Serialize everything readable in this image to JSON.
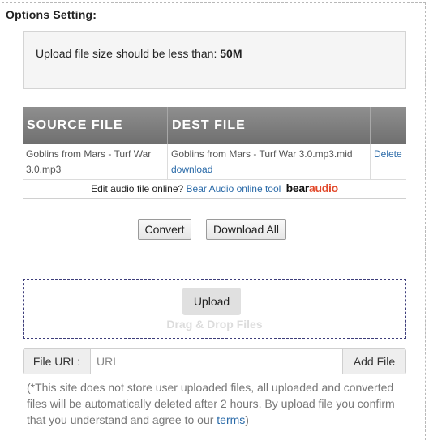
{
  "heading": "Options Setting:",
  "notice": {
    "text": "Upload file size should be less than: ",
    "limit": "50M"
  },
  "table": {
    "headers": [
      "SOURCE FILE",
      "DEST FILE",
      ""
    ],
    "rows": [
      {
        "source": "Goblins from Mars - Turf War 3.0.mp3",
        "dest": "Goblins from Mars - Turf War 3.0.mp3.mid",
        "download_label": "download",
        "delete_label": "Delete"
      }
    ]
  },
  "edit_line": {
    "text": "Edit audio file online?",
    "link": "Bear Audio online tool",
    "brand_part1": "bear",
    "brand_part2": "audio"
  },
  "buttons": {
    "convert": "Convert",
    "download_all": "Download All"
  },
  "dropzone": {
    "upload_label": "Upload",
    "hint": "Drag & Drop Files"
  },
  "url_field": {
    "label": "File URL:",
    "placeholder": "URL",
    "value": "",
    "add_label": "Add File"
  },
  "footnote": {
    "text": "(*This site does not store user uploaded files, all uploaded and converted files will be automatically deleted after 2 hours, By upload file you confirm that you understand and agree to our ",
    "link": "terms",
    "close": ")"
  },
  "colors": {
    "header_bg": "#7f7f7f",
    "link": "#2a6aa8",
    "brand_accent": "#e2492b",
    "dropzone_border": "#3d3d7a"
  }
}
